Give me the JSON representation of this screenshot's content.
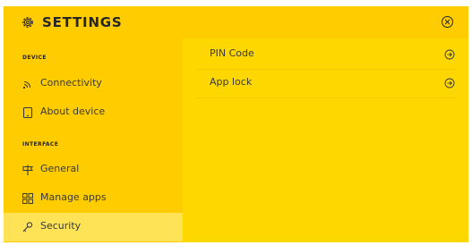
{
  "header": {
    "title": "SETTINGS",
    "icon": "gear-icon",
    "close_icon": "close-icon"
  },
  "sidebar": {
    "sections": [
      {
        "label": "DEVICE",
        "items": [
          {
            "label": "Connectivity",
            "icon": "wifi-icon"
          },
          {
            "label": "About device",
            "icon": "tablet-icon"
          }
        ]
      },
      {
        "label": "INTERFACE",
        "items": [
          {
            "label": "General",
            "icon": "signpost-icon"
          },
          {
            "label": "Manage apps",
            "icon": "grid-icon"
          },
          {
            "label": "Security",
            "icon": "key-icon",
            "active": true
          }
        ]
      }
    ]
  },
  "main": {
    "rows": [
      {
        "label": "PIN Code",
        "icon": "arrow-right-circle-icon"
      },
      {
        "label": "App lock",
        "icon": "arrow-right-circle-icon"
      }
    ]
  },
  "colors": {
    "header_bg": "#ffcc00",
    "sidebar_bg": "#ffcc00",
    "main_bg": "#fed700",
    "active_item_bg": "#ffe356",
    "text": "#262626"
  }
}
